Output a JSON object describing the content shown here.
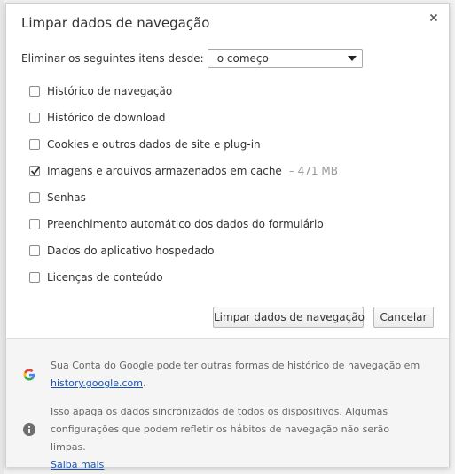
{
  "dialog": {
    "title": "Limpar dados de navegação",
    "close_icon": "close-icon"
  },
  "time_range": {
    "label": "Eliminar os seguintes itens desde:",
    "selected": "o começo"
  },
  "options": [
    {
      "label": "Histórico de navegação",
      "checked": false,
      "size": ""
    },
    {
      "label": "Histórico de download",
      "checked": false,
      "size": ""
    },
    {
      "label": "Cookies e outros dados de site e plug-in",
      "checked": false,
      "size": ""
    },
    {
      "label": "Imagens e arquivos armazenados em cache",
      "checked": true,
      "size": "– 471 MB"
    },
    {
      "label": "Senhas",
      "checked": false,
      "size": ""
    },
    {
      "label": "Preenchimento automático dos dados do formulário",
      "checked": false,
      "size": ""
    },
    {
      "label": "Dados do aplicativo hospedado",
      "checked": false,
      "size": ""
    },
    {
      "label": "Licenças de conteúdo",
      "checked": false,
      "size": ""
    }
  ],
  "buttons": {
    "clear_label": "Limpar dados de navegação",
    "cancel_label": "Cancelar"
  },
  "footer": {
    "google_icon": "google-g-icon",
    "info_icon": "info-icon",
    "google_text": "Sua Conta do Google pode ter outras formas de histórico de navegação em",
    "google_link": "history.google.com",
    "google_text_end": ".",
    "sync_text": "Isso apaga os dados sincronizados de todos os dispositivos. Algumas configurações que podem refletir os hábitos de navegação não serão limpas.",
    "learn_more": "Saiba mais"
  },
  "colors": {
    "link": "#1a55b5",
    "footer_bg": "#f5f5f5",
    "text": "#333333",
    "muted": "#999999"
  }
}
